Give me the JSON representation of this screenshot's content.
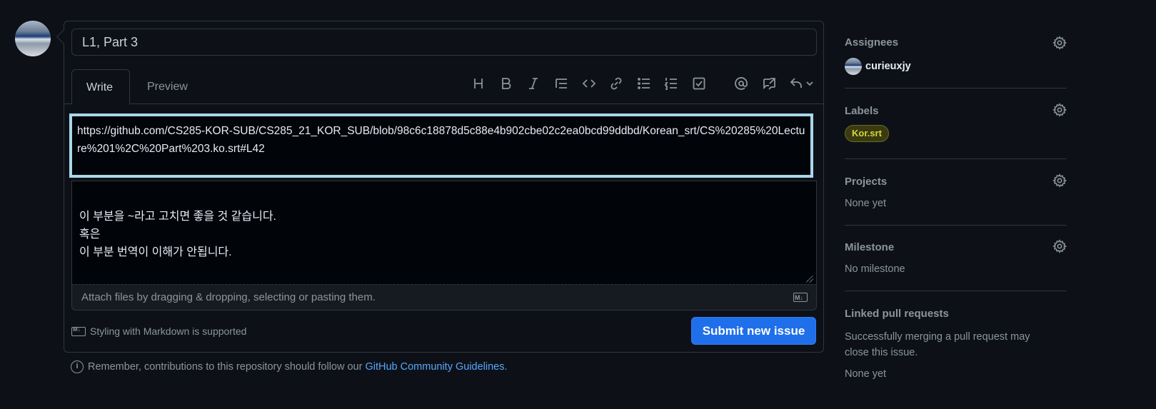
{
  "issue_form": {
    "title_value": "L1, Part 3",
    "tabs": {
      "write": "Write",
      "preview": "Preview"
    },
    "url_text": "https://github.com/CS285-KOR-SUB/CS285_21_KOR_SUB/blob/98c6c18878d5c88e4b902cbe02c2ea0bcd99ddbd/Korean_srt/CS%20285%20Lecture%201%2C%20Part%203.ko.srt#L42",
    "body_text": "이 부분을 ~라고 고치면 좋을 것 같습니다.\n혹은\n이 부분 번역이 이해가 안됩니다.",
    "attach_hint": "Attach files by dragging & dropping, selecting or pasting them.",
    "markdown_note": "Styling with Markdown is supported",
    "submit_label": "Submit new issue",
    "guidelines_prefix": "Remember, contributions to this repository should follow our",
    "guidelines_link": "GitHub Community Guidelines",
    "guidelines_suffix": "."
  },
  "toolbar_icons": [
    "heading-icon",
    "bold-icon",
    "italic-icon",
    "quote-icon",
    "code-icon",
    "link-icon",
    "bulleted-list-icon",
    "numbered-list-icon",
    "task-list-icon",
    "mention-icon",
    "reference-icon",
    "undo-icon"
  ],
  "sidebar": {
    "assignees": {
      "heading": "Assignees",
      "user": "curieuxjy"
    },
    "labels": {
      "heading": "Labels",
      "label": "Kor.srt"
    },
    "projects": {
      "heading": "Projects",
      "value": "None yet"
    },
    "milestone": {
      "heading": "Milestone",
      "value": "No milestone"
    },
    "linked_prs": {
      "heading": "Linked pull requests",
      "description": "Successfully merging a pull request may close this issue.",
      "value": "None yet"
    }
  },
  "colors": {
    "background": "#0d1117",
    "accent": "#1f6feb",
    "link": "#58a6ff",
    "highlight_border": "#a8d8ea",
    "label_text": "#d7d63a"
  }
}
